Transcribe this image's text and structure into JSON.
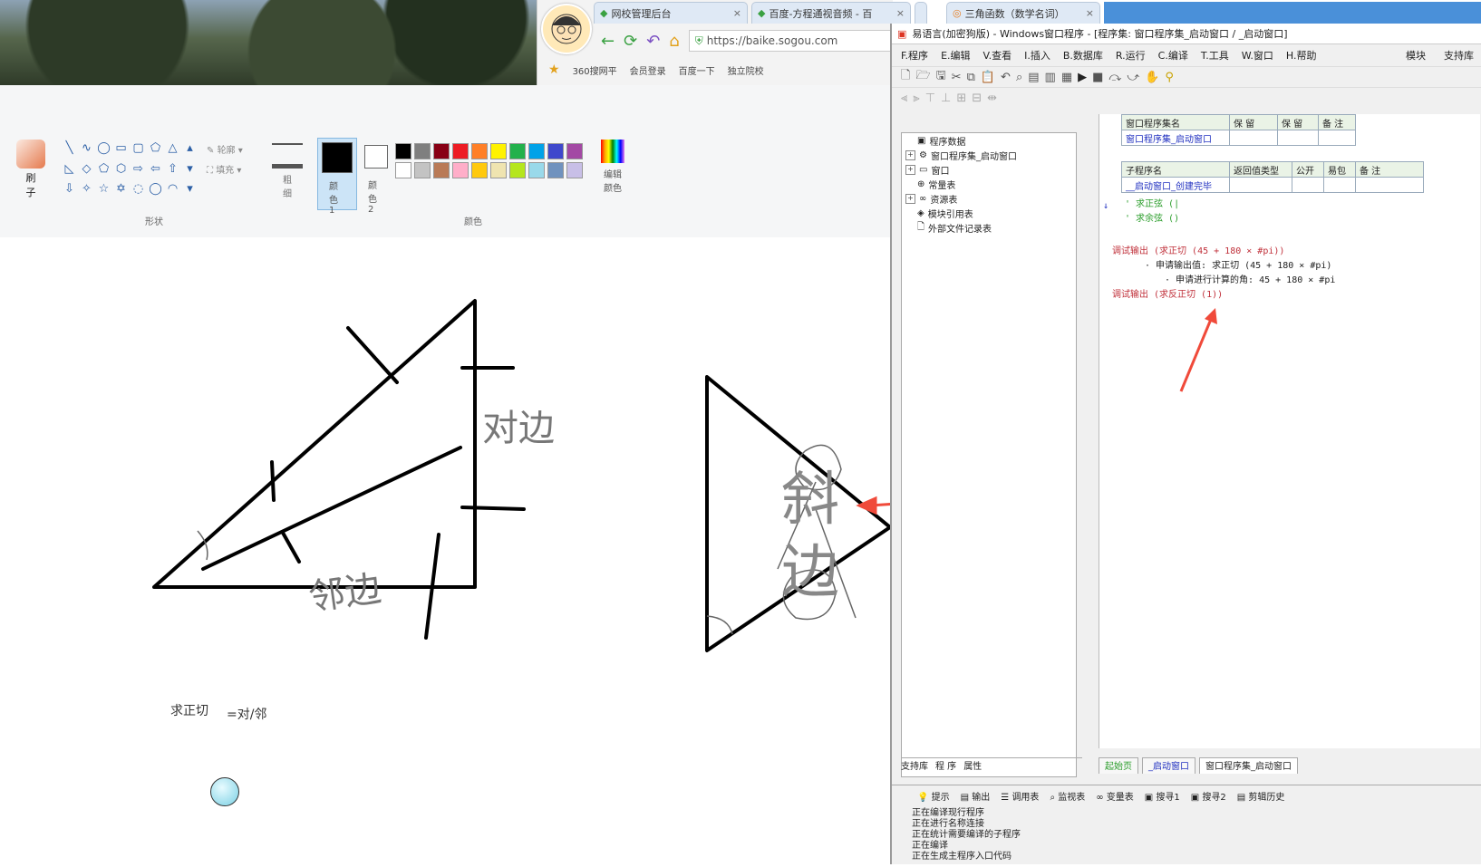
{
  "browser": {
    "tabs": [
      {
        "label": "网校管理后台",
        "close": "×"
      },
      {
        "label": "百度-方程通视音频 - 百",
        "close": "×"
      },
      {
        "label": "三角函数（数学名词）",
        "close": "×"
      }
    ],
    "url": "https://baike.sogou.com",
    "bookmarks": [
      "360搜网平",
      "会员登录",
      "百度一下",
      "独立院校"
    ]
  },
  "paint": {
    "brush_label": "刷子",
    "shapes_group": "形状",
    "outline_label": "轮廓",
    "fill_label": "填充",
    "size_label": "粗细",
    "color1_label": "颜色 1",
    "color2_label": "颜色 2",
    "colors_group": "颜色",
    "edit_colors_label": "编辑颜色",
    "color1": "#000000",
    "color2": "#ffffff",
    "palette": [
      "#000000",
      "#7f7f7f",
      "#880015",
      "#ed1c24",
      "#ff7f27",
      "#fff200",
      "#22b14c",
      "#00a2e8",
      "#3f48cc",
      "#a349a4",
      "#ffffff",
      "#c3c3c3",
      "#b97a57",
      "#ffaec9",
      "#ffc90e",
      "#efe4b0",
      "#b5e61d",
      "#99d9ea",
      "#7092be",
      "#c8bfe7"
    ],
    "canvas": {
      "annotation_duibi": "对边",
      "annotation_linbian": "邻边",
      "annotation_xiebian": "斜边",
      "formula_label": "求正切",
      "formula_value": "=对/邻"
    }
  },
  "ide": {
    "title": "易语言(加密狗版) - Windows窗口程序 - [程序集: 窗口程序集_启动窗口 / _启动窗口]",
    "menu": [
      "F.程序",
      "E.编辑",
      "V.查看",
      "I.插入",
      "B.数据库",
      "R.运行",
      "C.编译",
      "T.工具",
      "W.窗口",
      "H.帮助"
    ],
    "menu_right": [
      "模块",
      "支持库"
    ],
    "tree": [
      {
        "label": "程序数据",
        "exp": ""
      },
      {
        "label": "窗口程序集_启动窗口",
        "exp": "+"
      },
      {
        "label": "窗口",
        "exp": "+"
      },
      {
        "label": "常量表",
        "exp": ""
      },
      {
        "label": "资源表",
        "exp": "+"
      },
      {
        "label": "模块引用表",
        "exp": ""
      },
      {
        "label": "外部文件记录表",
        "exp": ""
      }
    ],
    "table1": {
      "headers": [
        "窗口程序集名",
        "保 留",
        "保 留",
        "备 注"
      ],
      "values": [
        "窗口程序集_启动窗口",
        "",
        "",
        ""
      ]
    },
    "table2": {
      "headers": [
        "子程序名",
        "返回值类型",
        "公开",
        "易包",
        "备 注"
      ],
      "values": [
        "__启动窗口_创建完毕",
        "",
        "",
        "",
        ""
      ]
    },
    "code": [
      "' 求正弦 (|",
      "' 求余弦 ()",
      "调试输出 (求正切 (45 + 180 × #pi))",
      "· 申请输出值:  求正切 (45 + 180 × #pi)",
      "· 申请进行计算的角:  45 + 180 × #pi",
      "调试输出 (求反正切 (1))"
    ],
    "bottom_tabs": [
      "支持库",
      "程 序",
      "属性"
    ],
    "doc_tabs": [
      "起始页",
      "_启动窗口",
      "窗口程序集_启动窗口"
    ],
    "output_tabs": [
      "提示",
      "输出",
      "调用表",
      "监视表",
      "变量表",
      "搜寻1",
      "搜寻2",
      "剪辑历史"
    ],
    "output_lines": [
      "正在编译现行程序",
      "正在进行名称连接",
      "正在统计需要编译的子程序",
      "正在编译",
      "正在生成主程序入口代码"
    ]
  }
}
